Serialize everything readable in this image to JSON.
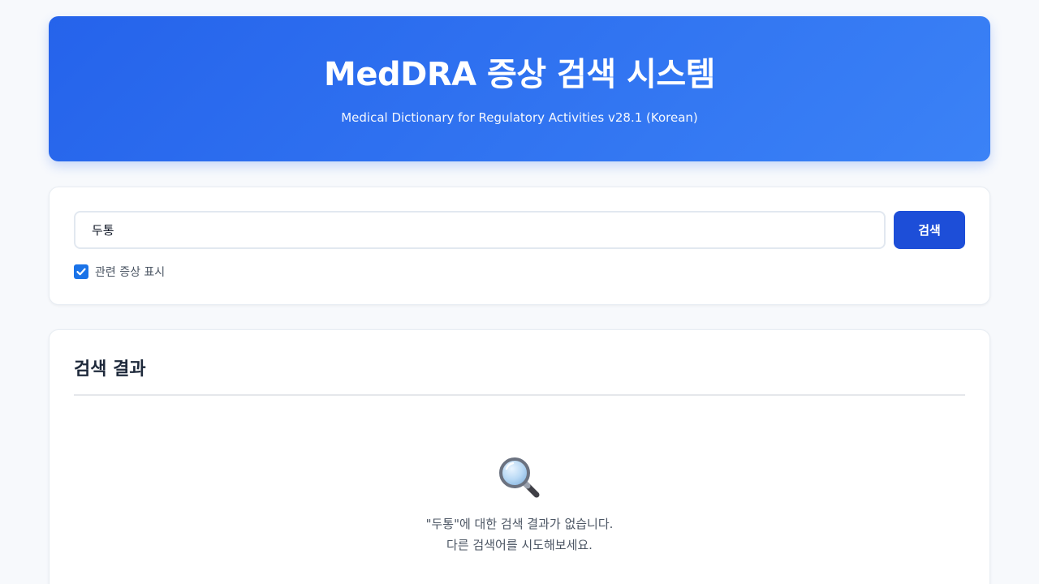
{
  "header": {
    "title": "MedDRA 증상 검색 시스템",
    "subtitle": "Medical Dictionary for Regulatory Activities v28.1 (Korean)",
    "gradient_start": "#2563eb",
    "gradient_end": "#3b82f6"
  },
  "search": {
    "value": "두통",
    "button_label": "검색",
    "button_color": "#1d4ed8",
    "related_checkbox_label": "관련 증상 표시",
    "related_checked": true
  },
  "results": {
    "title": "검색 결과",
    "empty_icon": "magnifying-glass-icon",
    "empty_message_line1": "\"두통\"에 대한 검색 결과가 없습니다.",
    "empty_message_line2": "다른 검색어를 시도해보세요."
  }
}
